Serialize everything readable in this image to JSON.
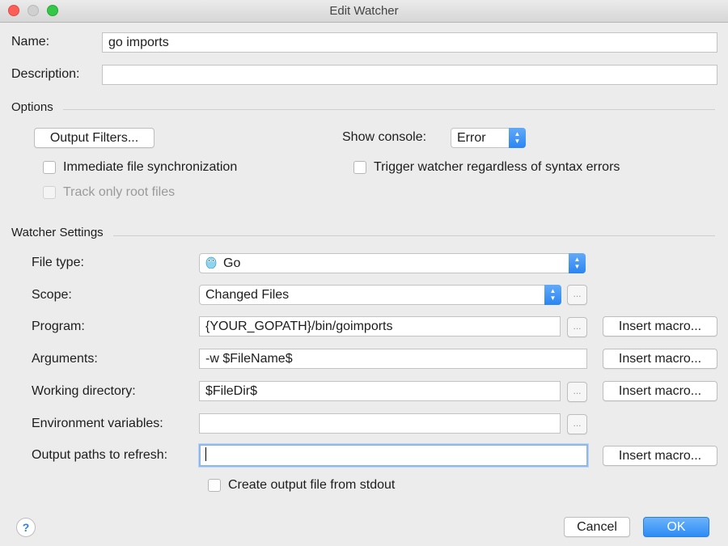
{
  "window": {
    "title": "Edit Watcher"
  },
  "name": {
    "label": "Name:",
    "value": "go imports"
  },
  "description": {
    "label": "Description:",
    "value": ""
  },
  "options": {
    "title": "Options",
    "output_filters_button": "Output Filters...",
    "show_console_label": "Show console:",
    "show_console_value": "Error",
    "immediate_sync": {
      "label": "Immediate file synchronization",
      "checked": false
    },
    "trigger_regardless": {
      "label": "Trigger watcher regardless of syntax errors",
      "checked": false
    },
    "track_root": {
      "label": "Track only root files",
      "checked": false,
      "enabled": false
    }
  },
  "watcher_settings": {
    "title": "Watcher Settings",
    "file_type": {
      "label": "File type:",
      "value": "Go",
      "icon": "gopher-icon"
    },
    "scope": {
      "label": "Scope:",
      "value": "Changed Files"
    },
    "program": {
      "label": "Program:",
      "value": "{YOUR_GOPATH}/bin/goimports"
    },
    "arguments": {
      "label": "Arguments:",
      "value": "-w $FileName$"
    },
    "working_directory": {
      "label": "Working directory:",
      "value": "$FileDir$"
    },
    "environment_variables": {
      "label": "Environment variables:",
      "value": ""
    },
    "output_paths": {
      "label": "Output paths to refresh:",
      "value": ""
    },
    "create_output": {
      "label": "Create output file from stdout",
      "checked": false
    },
    "insert_macro_label": "Insert macro...",
    "browse_label": "..."
  },
  "footer": {
    "help": "?",
    "cancel": "Cancel",
    "ok": "OK"
  }
}
